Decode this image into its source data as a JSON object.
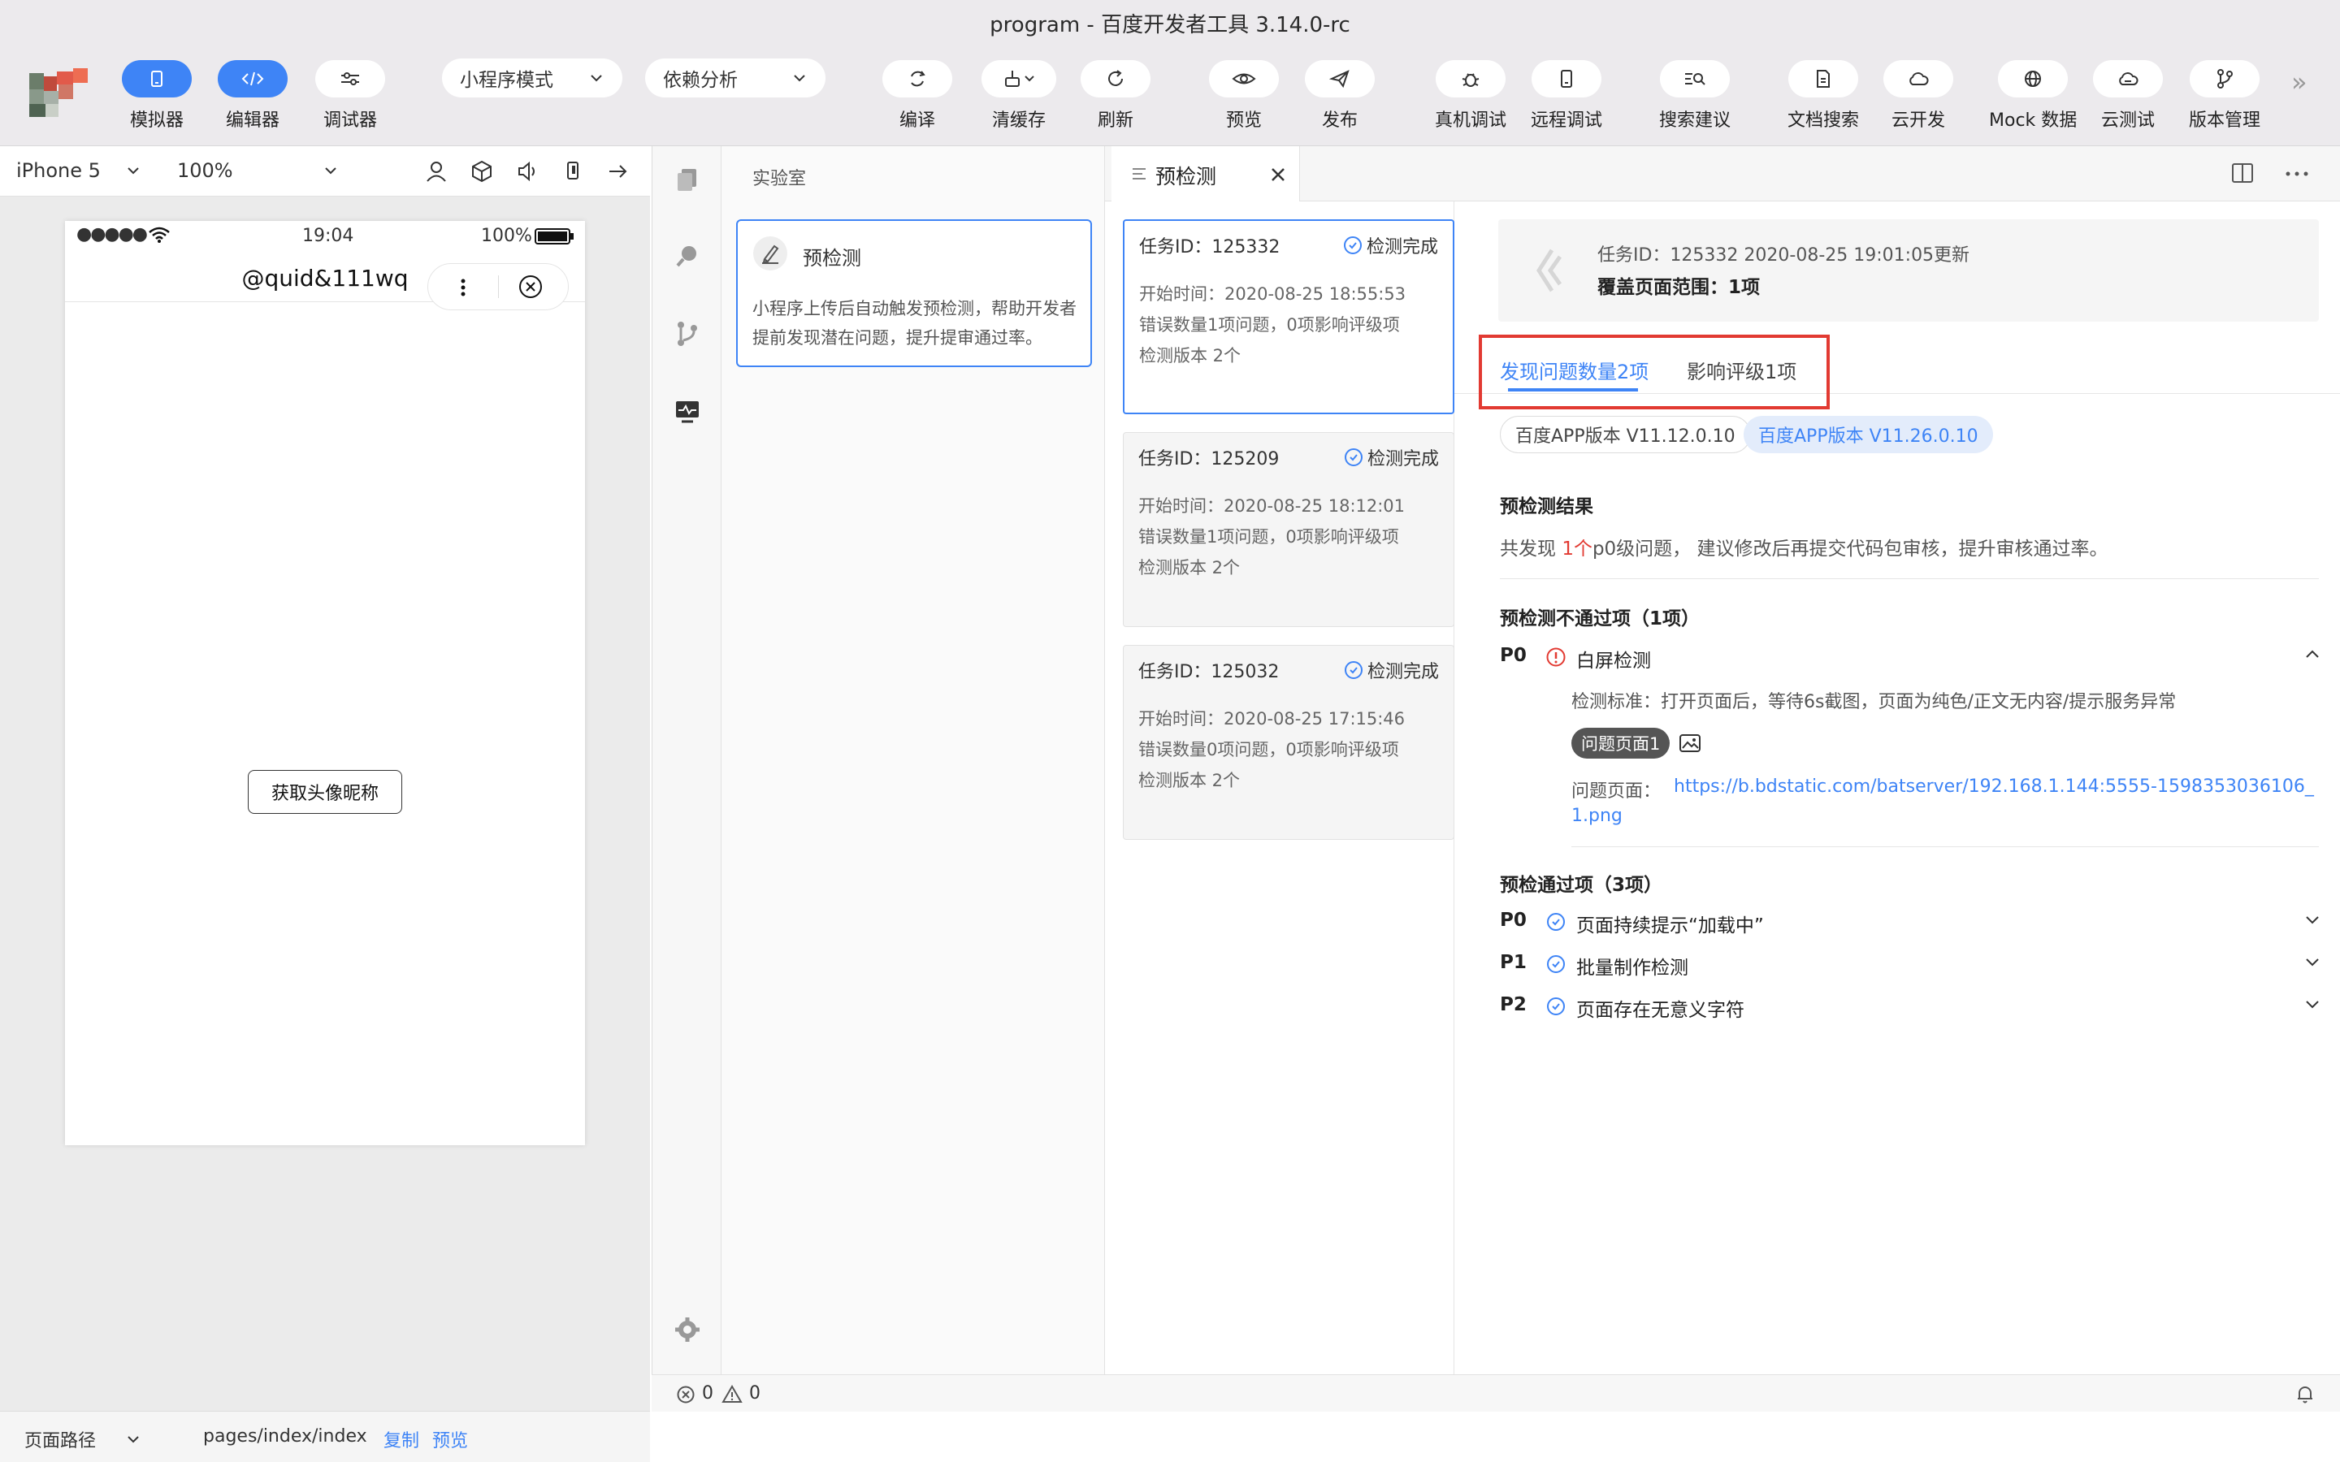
{
  "window": {
    "title": "program - 百度开发者工具 3.14.0-rc"
  },
  "toolbar": {
    "simulator": "模拟器",
    "editor": "编辑器",
    "debugger": "调试器",
    "mode_select": "小程序模式",
    "analysis_select": "依赖分析",
    "compile": "编译",
    "clear_cache": "清缓存",
    "refresh": "刷新",
    "preview": "预览",
    "publish": "发布",
    "device_debug": "真机调试",
    "remote_debug": "远程调试",
    "search_suggest": "搜索建议",
    "doc_search": "文档搜索",
    "cloud_dev": "云开发",
    "mock": "Mock 数据",
    "cloud_test": "云测试",
    "version_mgmt": "版本管理",
    "more": "»"
  },
  "simulator": {
    "device": "iPhone 5",
    "zoom": "100%",
    "status_time": "19:04",
    "status_battery": "100%",
    "signal": "●●●●●",
    "nav_title": "@quid&111wq",
    "button": "获取头像昵称"
  },
  "bottom": {
    "path_label": "页面路径",
    "path": "pages/index/index",
    "copy": "复制",
    "preview": "预览"
  },
  "lab": {
    "header": "实验室",
    "card_title": "预检测",
    "card_desc": "小程序上传后自动触发预检测，帮助开发者提前发现潜在问题，提升提审通过率。"
  },
  "tab": {
    "label": "预检测"
  },
  "tasks": [
    {
      "id": "任务ID：125332",
      "status": "检测完成",
      "start": "开始时间：2020-08-25 18:55:53",
      "errors": "错误数量1项问题，0项影响评级项",
      "version": "检测版本 2个"
    },
    {
      "id": "任务ID：125209",
      "status": "检测完成",
      "start": "开始时间：2020-08-25 18:12:01",
      "errors": "错误数量1项问题，0项影响评级项",
      "version": "检测版本 2个"
    },
    {
      "id": "任务ID：125032",
      "status": "检测完成",
      "start": "开始时间：2020-08-25 17:15:46",
      "errors": "错误数量0项问题，0项影响评级项",
      "version": "检测版本 2个"
    }
  ],
  "detail": {
    "summary_line": "任务ID：125332 2020-08-25 19:01:05更新",
    "coverage": "覆盖页面范围：1项",
    "tab_active": "发现问题数量2项",
    "tab_other": "影响评级1项",
    "version_a": "百度APP版本 V11.12.0.10",
    "version_b": "百度APP版本 V11.26.0.10",
    "result_title": "预检测结果",
    "result_pre": "共发现 ",
    "result_count": "1个",
    "result_post": "p0级问题， 建议修改后再提交代码包审核，提升审核通过率。",
    "fail_title": "预检测不通过项（1项）",
    "fail_level": "P0",
    "fail_name": "白屏检测",
    "fail_standard": "检测标准：打开页面后，等待6s截图，页面为纯色/正文无内容/提示服务异常",
    "issue_tag": "问题页面1",
    "issue_label": "问题页面：",
    "issue_url_1": "https://b.bdstatic.com/batserver/192.168.1.144:5555-1598353036106_",
    "issue_url_2": "1.png",
    "pass_title": "预检通过项（3项）",
    "pass_items": [
      {
        "level": "P0",
        "name": "页面持续提示“加载中”"
      },
      {
        "level": "P1",
        "name": "批量制作检测"
      },
      {
        "level": "P2",
        "name": "页面存在无意义字符"
      }
    ]
  },
  "statusbar": {
    "errors": "0",
    "warnings": "0"
  },
  "colors": {
    "accent": "#3e84f6",
    "error": "#e23a32",
    "frame": "#e23a32"
  }
}
